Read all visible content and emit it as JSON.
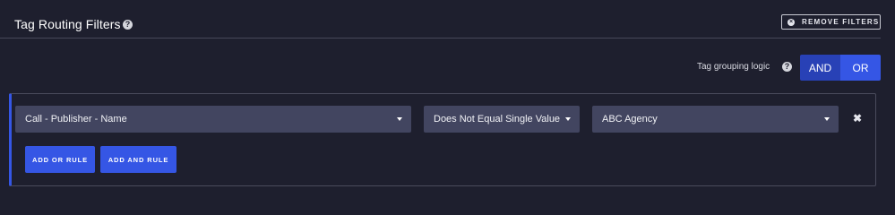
{
  "header": {
    "title": "Tag Routing Filters",
    "help_glyph": "?",
    "remove_filters_label": "REMOVE FILTERS"
  },
  "grouping": {
    "label": "Tag grouping logic",
    "help_glyph": "?",
    "options": [
      "AND",
      "OR"
    ],
    "selected": "OR"
  },
  "rule": {
    "field": "Call - Publisher - Name",
    "operator": "Does Not Equal Single Value",
    "value": "ABC Agency",
    "delete_glyph": "✖"
  },
  "actions": {
    "add_or_label": "ADD OR RULE",
    "add_and_label": "ADD AND RULE"
  },
  "colors": {
    "background": "#1e1f2e",
    "accent": "#3556e5",
    "accent_dark": "#2841b6",
    "select_bg": "#424560"
  }
}
